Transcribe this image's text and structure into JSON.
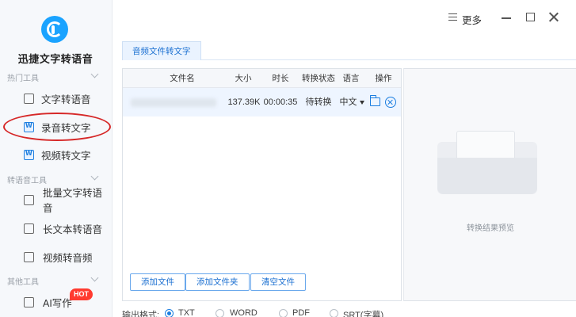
{
  "app": {
    "name": "迅捷文字转语音"
  },
  "titlebar": {
    "more_label": "更多"
  },
  "sidebar": {
    "sections": [
      {
        "label": "热门工具",
        "items": [
          {
            "label": "文字转语音",
            "icon": "text-to-speech-icon"
          },
          {
            "label": "录音转文字",
            "icon": "word-doc-icon",
            "active": true
          },
          {
            "label": "视频转文字",
            "icon": "word-doc-icon"
          }
        ]
      },
      {
        "label": "转语音工具",
        "items": [
          {
            "label": "批量文字转语音",
            "icon": "batch-icon"
          },
          {
            "label": "长文本转语音",
            "icon": "document-icon"
          },
          {
            "label": "视频转音频",
            "icon": "video-icon"
          }
        ]
      },
      {
        "label": "其他工具",
        "items": [
          {
            "label": "AI写作",
            "icon": "ai-write-icon",
            "badge": "HOT"
          }
        ]
      }
    ]
  },
  "tabs": [
    {
      "label": "音频文件转文字",
      "active": true
    }
  ],
  "table": {
    "columns": [
      "文件名",
      "大小",
      "时长",
      "转换状态",
      "语言",
      "操作"
    ],
    "rows": [
      {
        "filename": "",
        "size": "137.39K",
        "duration": "00:00:35",
        "status": "待转换",
        "language": "中文"
      }
    ]
  },
  "buttons": {
    "add_file": "添加文件",
    "add_folder": "添加文件夹",
    "clear_files": "清空文件"
  },
  "preview": {
    "label": "转换结果预览"
  },
  "output": {
    "label": "输出格式:",
    "options": [
      "TXT",
      "WORD",
      "PDF",
      "SRT(字幕)"
    ],
    "selected": "TXT"
  },
  "colors": {
    "accent": "#1a7de0",
    "highlight_circle": "#d62828",
    "hot_badge": "#ff3b30"
  }
}
